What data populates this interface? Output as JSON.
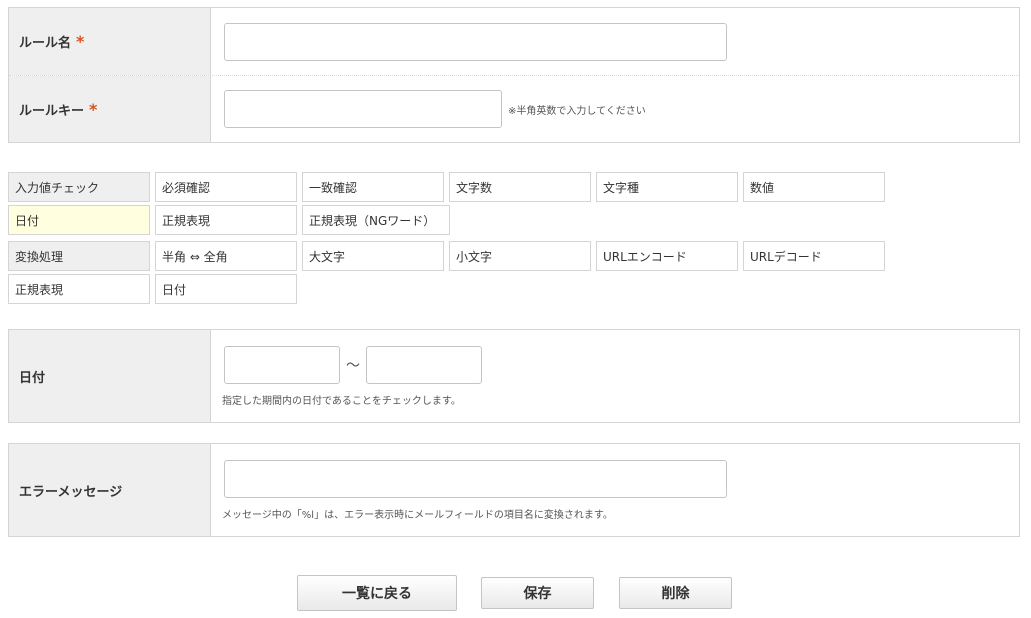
{
  "rule_name": {
    "label": "ルール名",
    "required_mark": "*",
    "value": ""
  },
  "rule_key": {
    "label": "ルールキー",
    "required_mark": "*",
    "value": "",
    "hint": "※半角英数で入力してください"
  },
  "validation": {
    "header": "入力値チェック",
    "options": [
      "必須確認",
      "一致確認",
      "文字数",
      "文字種",
      "数値"
    ],
    "options_row2": [
      "日付",
      "正規表現",
      "正規表現（NGワード）"
    ]
  },
  "conversion": {
    "header": "変換処理",
    "options": [
      "半角 ⇔ 全角",
      "大文字",
      "小文字",
      "URLエンコード",
      "URLデコード"
    ],
    "options_row2": [
      "正規表現",
      "日付"
    ]
  },
  "date": {
    "label": "日付",
    "from_value": "",
    "separator": "～",
    "to_value": "",
    "note": "指定した期間内の日付であることをチェックします。"
  },
  "error_message": {
    "label": "エラーメッセージ",
    "value": "",
    "note": "メッセージ中の「%l」は、エラー表示時にメールフィールドの項目名に変換されます。"
  },
  "buttons": {
    "back": "一覧に戻る",
    "save": "保存",
    "delete": "削除"
  },
  "colors": {
    "required": "#d9531e",
    "active_option": "#ffffe0",
    "label_bg": "#efefef"
  }
}
